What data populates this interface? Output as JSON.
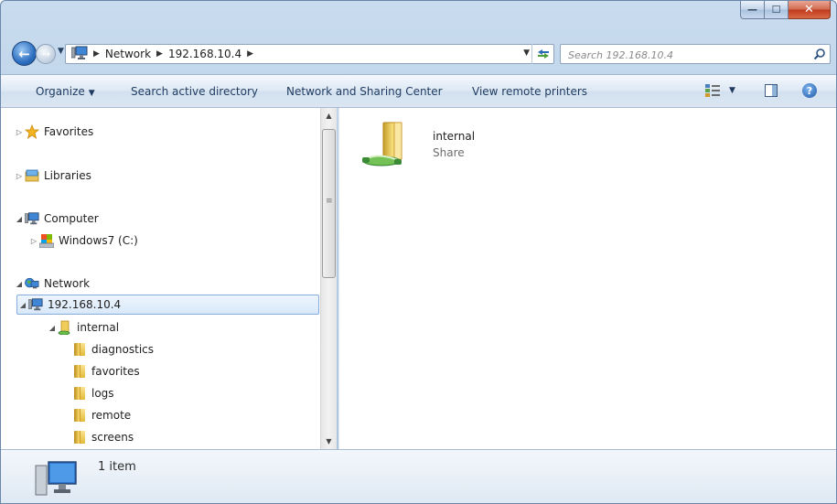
{
  "window": {
    "caption_min": "—",
    "caption_max": "☐",
    "caption_close": "✕"
  },
  "address": {
    "crumbs": [
      "Network",
      "192.168.10.4"
    ],
    "search_placeholder": "Search 192.168.10.4"
  },
  "toolbar": {
    "organize": "Organize",
    "search_ad": "Search active directory",
    "network_center": "Network and Sharing Center",
    "remote_printers": "View remote printers",
    "help": "?"
  },
  "nav": {
    "favorites": "Favorites",
    "libraries": "Libraries",
    "computer": "Computer",
    "drive": "Windows7 (C:)",
    "network": "Network",
    "host": "192.168.10.4",
    "share": "internal",
    "folders": [
      "diagnostics",
      "favorites",
      "logs",
      "remote",
      "screens"
    ]
  },
  "content": {
    "items": [
      {
        "name": "internal",
        "type": "Share"
      }
    ]
  },
  "details": {
    "count": "1 item"
  },
  "colors": {
    "selection_border": "#84acdd",
    "accent": "#2d6fc1"
  }
}
